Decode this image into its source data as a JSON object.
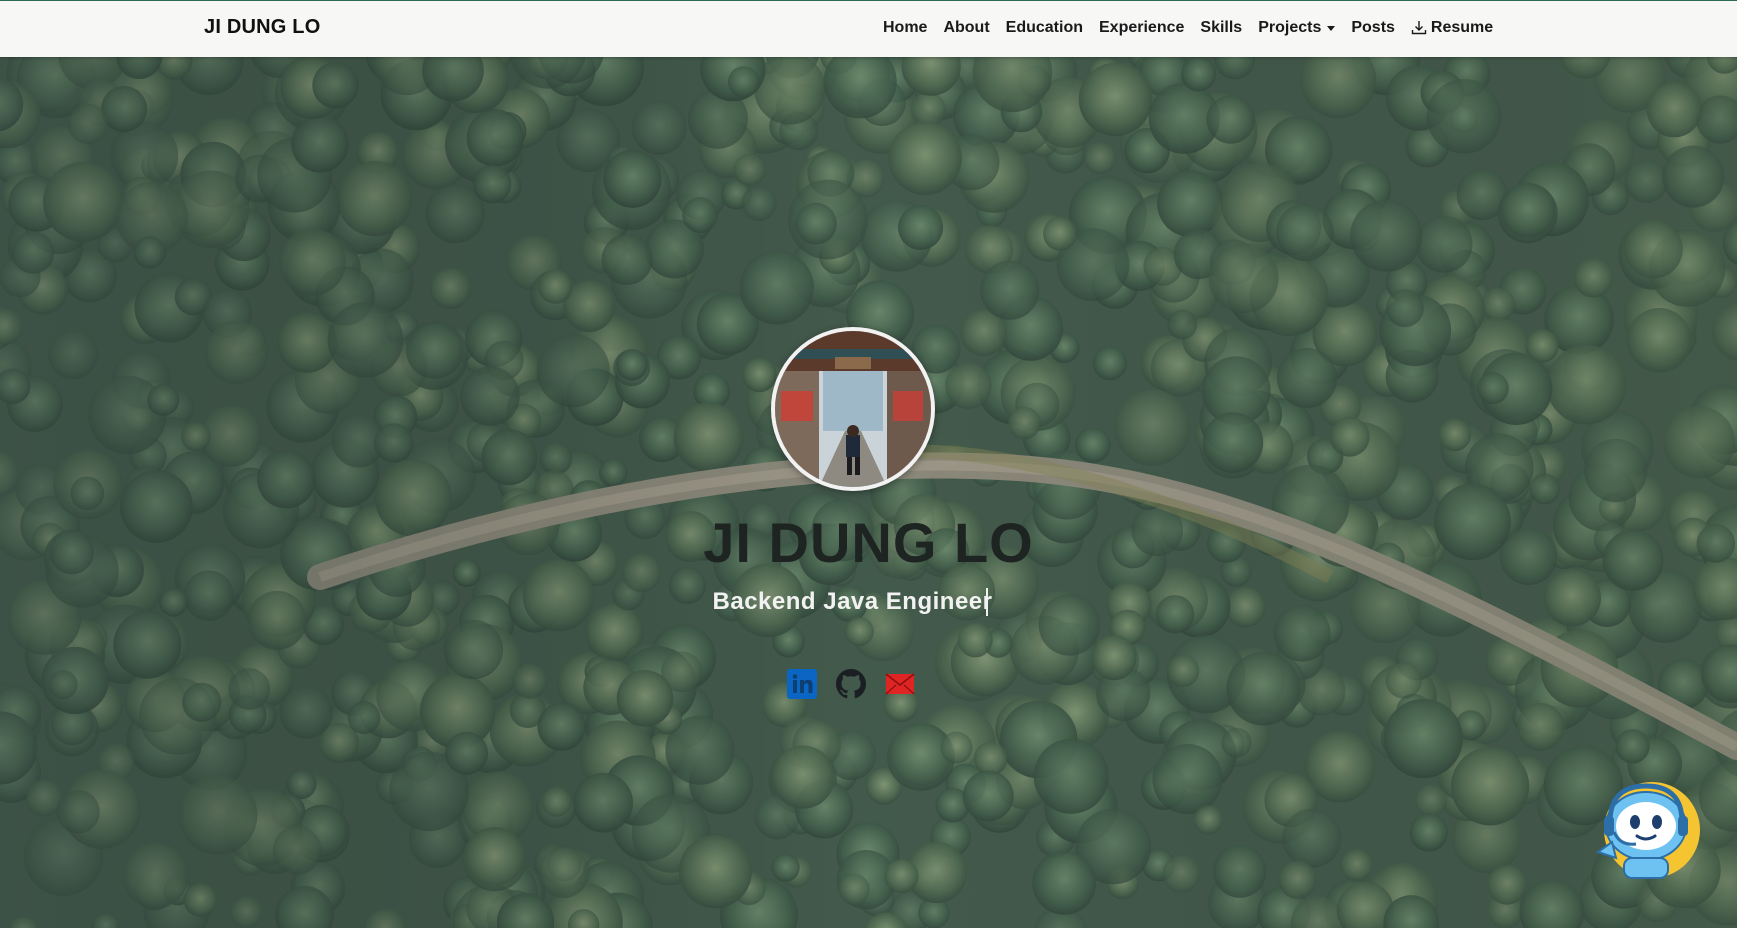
{
  "navbar": {
    "brand": "JI DUNG LO",
    "items": [
      {
        "label": "Home"
      },
      {
        "label": "About"
      },
      {
        "label": "Education"
      },
      {
        "label": "Experience"
      },
      {
        "label": "Skills"
      },
      {
        "label": "Projects"
      },
      {
        "label": "Posts"
      },
      {
        "label": "Resume"
      }
    ]
  },
  "hero": {
    "name": "JI DUNG LO",
    "title": "Backend Java Engineer",
    "socials": [
      {
        "icon": "linkedin-icon",
        "color": "#0a66c2"
      },
      {
        "icon": "github-icon",
        "color": "#1b1f23"
      },
      {
        "icon": "mail-icon",
        "color": "#e02424"
      }
    ]
  },
  "colors": {
    "navbar_bg": "#f7f7f5",
    "forest": "#3d5646",
    "road": "#a9a08f"
  }
}
